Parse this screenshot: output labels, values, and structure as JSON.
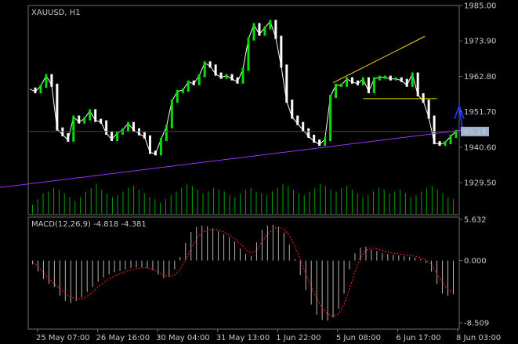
{
  "chart_data": [
    {
      "type": "candlestick",
      "title": "XAUUSD, H1",
      "ylim": [
        1929.5,
        1985.0
      ],
      "y_ticks": [
        "1985.00",
        "1973.90",
        "1962.80",
        "1951.70",
        "1940.60",
        "1929.50"
      ],
      "current_price_label": "45.14",
      "x_ticks": [
        "25 May 07:00",
        "26 May 16:00",
        "30 May 04:00",
        "31 May 13:00",
        "1 Jun 22:00",
        "5 Jun 08:00",
        "6 Jun 17:00",
        "8 Jun 03:00"
      ],
      "close_path": [
        [
          0,
          1958.8
        ],
        [
          4,
          1958.0
        ],
        [
          8,
          1959.7
        ],
        [
          12,
          1963.0
        ],
        [
          16,
          1960.0
        ],
        [
          20,
          1946.3
        ],
        [
          24,
          1944.5
        ],
        [
          28,
          1942.8
        ],
        [
          32,
          1950.0
        ],
        [
          36,
          1948.5
        ],
        [
          40,
          1949.5
        ],
        [
          44,
          1952.0
        ],
        [
          48,
          1949.0
        ],
        [
          52,
          1948.5
        ],
        [
          56,
          1945.0
        ],
        [
          60,
          1943.0
        ],
        [
          64,
          1945.0
        ],
        [
          68,
          1946.0
        ],
        [
          72,
          1948.0
        ],
        [
          76,
          1946.0
        ],
        [
          80,
          1944.8
        ],
        [
          84,
          1943.8
        ],
        [
          88,
          1939.0
        ],
        [
          92,
          1938.5
        ],
        [
          96,
          1943.0
        ],
        [
          100,
          1947.0
        ],
        [
          104,
          1955.0
        ],
        [
          108,
          1958.0
        ],
        [
          112,
          1958.5
        ],
        [
          116,
          1961.0
        ],
        [
          120,
          1960.5
        ],
        [
          124,
          1963.0
        ],
        [
          128,
          1967.0
        ],
        [
          132,
          1966.0
        ],
        [
          136,
          1963.5
        ],
        [
          140,
          1962.5
        ],
        [
          144,
          1963.0
        ],
        [
          148,
          1962.0
        ],
        [
          152,
          1961.0
        ],
        [
          156,
          1965.0
        ],
        [
          160,
          1974.5
        ],
        [
          164,
          1979.0
        ],
        [
          168,
          1976.0
        ],
        [
          172,
          1978.0
        ],
        [
          176,
          1980.0
        ],
        [
          180,
          1975.0
        ],
        [
          184,
          1966.0
        ],
        [
          188,
          1955.0
        ],
        [
          192,
          1950.0
        ],
        [
          196,
          1948.0
        ],
        [
          200,
          1946.0
        ],
        [
          204,
          1944.0
        ],
        [
          208,
          1942.5
        ],
        [
          212,
          1941.5
        ],
        [
          216,
          1943.0
        ],
        [
          220,
          1956.5
        ],
        [
          224,
          1960.0
        ],
        [
          228,
          1960.0
        ],
        [
          232,
          1962.0
        ],
        [
          236,
          1961.0
        ],
        [
          240,
          1960.5
        ],
        [
          244,
          1962.0
        ],
        [
          248,
          1958.0
        ],
        [
          252,
          1962.0
        ],
        [
          256,
          1962.5
        ],
        [
          260,
          1962.5
        ],
        [
          264,
          1962.0
        ],
        [
          268,
          1962.0
        ],
        [
          272,
          1961.5
        ],
        [
          276,
          1960.0
        ],
        [
          280,
          1963.5
        ],
        [
          284,
          1957.0
        ],
        [
          288,
          1955.0
        ],
        [
          292,
          1950.0
        ],
        [
          296,
          1942.0
        ],
        [
          300,
          1941.5
        ],
        [
          304,
          1942.0
        ],
        [
          308,
          1944.0
        ],
        [
          312,
          1945.5
        ]
      ],
      "volume": [
        5,
        8,
        11,
        12,
        14,
        13,
        11,
        9,
        7,
        9,
        12,
        14,
        16,
        13,
        11,
        9,
        10,
        12,
        14,
        15,
        13,
        11,
        9,
        8,
        6,
        8,
        10,
        12,
        14,
        16,
        15,
        13,
        11,
        12,
        14,
        13,
        12,
        10,
        9,
        11,
        13,
        14,
        12,
        11,
        10,
        12,
        14,
        16,
        15,
        13,
        11,
        10,
        12,
        14,
        16,
        15,
        13,
        12,
        14,
        15,
        13,
        11,
        9,
        10,
        12,
        14,
        13,
        11,
        12,
        13,
        11,
        9,
        10,
        12,
        14,
        15,
        13,
        11,
        9,
        8
      ],
      "trendlines": [
        {
          "color": "#9b30ff",
          "points": [
            [
              -40,
              1927.0
            ],
            [
              320,
              1946.1
            ]
          ]
        },
        {
          "color": "#ffd700",
          "points": [
            [
              222,
              1960.8
            ],
            [
              289,
              1975.3
            ]
          ]
        },
        {
          "color": "#ffd700",
          "points": [
            [
              244,
              1955.8
            ],
            [
              298,
              1955.8
            ]
          ]
        }
      ],
      "arrow": {
        "color": "#1e3cff"
      }
    },
    {
      "type": "histogram",
      "title": "MACD(12,26,9) -4.818 -4.381",
      "ylim": [
        -8.509,
        5.632
      ],
      "y_ticks": [
        "5.632",
        "0.000",
        "-8.509"
      ],
      "macd": [
        -0.5,
        -1.5,
        -2.5,
        -3.2,
        -3.6,
        -4.8,
        -5.5,
        -5.8,
        -5.5,
        -5.0,
        -4.3,
        -3.6,
        -2.9,
        -2.3,
        -1.9,
        -1.6,
        -1.4,
        -1.2,
        -1.0,
        -0.9,
        -0.9,
        -1.0,
        -1.3,
        -1.9,
        -2.4,
        -2.2,
        -1.2,
        0.5,
        2.4,
        3.9,
        4.6,
        4.8,
        4.7,
        4.4,
        4.0,
        3.6,
        3.2,
        2.6,
        1.6,
        0.9,
        0.6,
        2.5,
        4.2,
        4.8,
        4.9,
        4.6,
        3.8,
        2.2,
        0.2,
        -2.0,
        -4.0,
        -6.0,
        -7.4,
        -8.1,
        -8.2,
        -7.8,
        -6.6,
        -4.5,
        -1.2,
        1.0,
        1.8,
        1.9,
        1.5,
        1.3,
        1.0,
        0.9,
        0.8,
        0.7,
        0.6,
        0.5,
        0.4,
        0.2,
        -0.3,
        -1.5,
        -3.2,
        -4.5,
        -4.8,
        -4.6
      ],
      "signal": [
        -0.3,
        -0.8,
        -1.6,
        -2.5,
        -3.2,
        -3.8,
        -4.5,
        -5.0,
        -5.2,
        -5.2,
        -4.9,
        -4.3,
        -3.6,
        -3.0,
        -2.5,
        -2.1,
        -1.8,
        -1.5,
        -1.3,
        -1.1,
        -1.0,
        -1.0,
        -1.2,
        -1.6,
        -2.0,
        -2.2,
        -2.0,
        -1.2,
        0.1,
        1.6,
        2.9,
        3.8,
        4.2,
        4.3,
        4.2,
        3.9,
        3.5,
        3.0,
        2.3,
        1.6,
        1.0,
        1.4,
        2.6,
        3.6,
        4.3,
        4.6,
        4.3,
        3.4,
        2.0,
        0.2,
        -1.8,
        -3.6,
        -5.2,
        -6.5,
        -7.3,
        -7.6,
        -7.3,
        -6.0,
        -3.9,
        -1.5,
        0.4,
        1.4,
        1.7,
        1.6,
        1.4,
        1.2,
        1.0,
        0.9,
        0.8,
        0.7,
        0.6,
        0.4,
        0.1,
        -0.6,
        -1.8,
        -3.0,
        -3.9,
        -4.4
      ]
    }
  ],
  "colors": {
    "background": "#000000",
    "frame": "#6e6e6e",
    "up": "#00e000",
    "down": "#ffffff",
    "volume": "#00a800",
    "macd": "#b4b4b4",
    "signal": "#ff2020",
    "label": "#c8c8c8"
  }
}
